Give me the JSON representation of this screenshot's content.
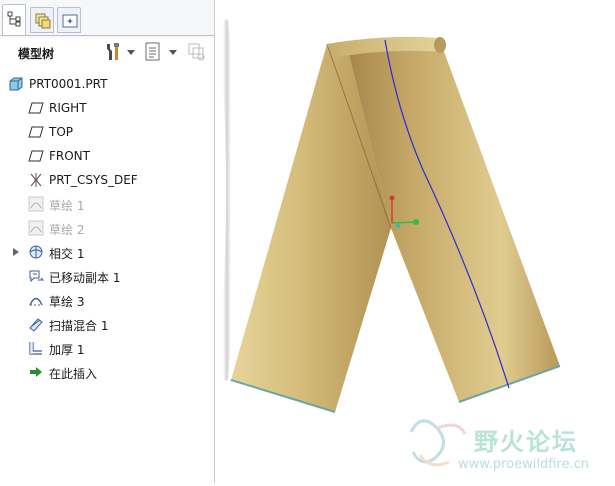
{
  "panel": {
    "tabs": [
      {
        "icon": "model-tree-tab-icon",
        "active": true
      },
      {
        "icon": "layers-tab-icon",
        "active": false
      },
      {
        "icon": "favorites-tab-icon",
        "active": false
      }
    ],
    "title": "模型树",
    "toolbar": [
      {
        "icon": "tools-icon"
      },
      {
        "icon": "tree-settings-icon"
      },
      {
        "icon": "filter-icon"
      }
    ]
  },
  "tree": {
    "root": {
      "label": "PRT0001.PRT",
      "icon": "part-icon"
    },
    "items": [
      {
        "label": "RIGHT",
        "icon": "datum-plane-icon",
        "dim": false
      },
      {
        "label": "TOP",
        "icon": "datum-plane-icon",
        "dim": false
      },
      {
        "label": "FRONT",
        "icon": "datum-plane-icon",
        "dim": false
      },
      {
        "label": "PRT_CSYS_DEF",
        "icon": "csys-icon",
        "dim": false
      },
      {
        "label": "草绘 1",
        "icon": "sketch-icon",
        "dim": true
      },
      {
        "label": "草绘 2",
        "icon": "sketch-icon",
        "dim": true
      },
      {
        "label": "相交 1",
        "icon": "intersect-icon",
        "dim": false,
        "expandable": true
      },
      {
        "label": "已移动副本 1",
        "icon": "moved-copy-icon",
        "dim": false
      },
      {
        "label": "草绘 3",
        "icon": "sketch-icon",
        "dim": false
      },
      {
        "label": "扫描混合 1",
        "icon": "swept-blend-icon",
        "dim": false
      },
      {
        "label": "加厚 1",
        "icon": "thicken-icon",
        "dim": false
      },
      {
        "label": "在此插入",
        "icon": "insert-here-icon",
        "dim": false
      }
    ]
  },
  "watermark": {
    "text": "野火论坛",
    "url": "www.proewildfire.cn"
  },
  "colors": {
    "surface_light": "#e2cf93",
    "surface_mid": "#c8ac68",
    "surface_dark": "#8f7440",
    "curve": "#2b2bd6",
    "edge": "#6aa6a8"
  }
}
